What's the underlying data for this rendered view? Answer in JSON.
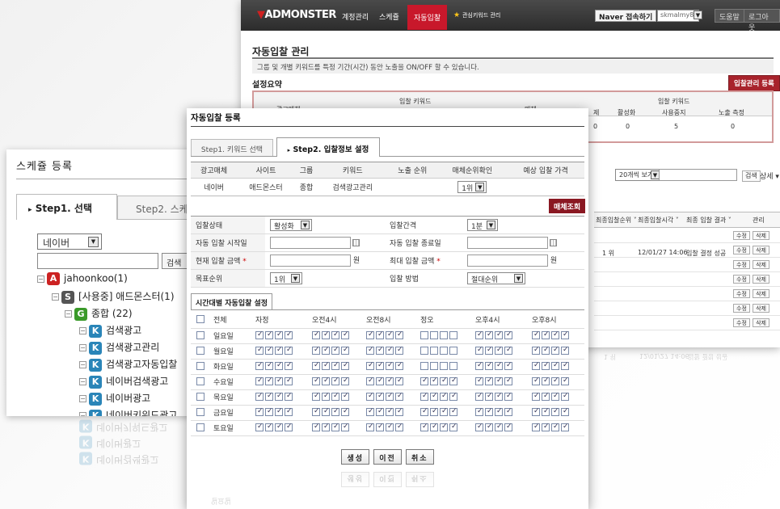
{
  "back": {
    "logo": "ADMONSTER",
    "nav": [
      "계정관리",
      "스케쥴",
      "자동입찰",
      "관심키워드 관리"
    ],
    "naver_label": "Naver 접속하기",
    "account_value": "skmalmy88",
    "help_label": "도움말",
    "logout_label": "로그아웃",
    "page_title": "자동입찰 관리",
    "description": "그룹 및 개별 키워드를 특정 기간(시간) 동안 노출을 ON/OFF 할 수 있습니다.",
    "summary_label": "설정요약",
    "register_button": "입찰관리 등록",
    "summary": {
      "col_media": "광고매체",
      "col_bid_kw": "입찰 키워드",
      "col_media2": "매체",
      "col_bid_kw2": "입찰 키워드",
      "col_stop_frag": "제",
      "col_active": "활성화",
      "col_paused": "사용중지",
      "col_exposure": "노출 측정",
      "val_left": "0",
      "val_active": "0",
      "val_paused": "5",
      "val_exposure": "0"
    },
    "page_size": "20개씩 보기",
    "search_btn": "검색",
    "detail_label": "상세",
    "col_last_rank": "최종입찰순위",
    "col_last_time": "최종입찰시각",
    "col_last_result": "최종 입찰 결과",
    "col_manage": "관리",
    "row_rank": "1 위",
    "row_time": "12/01/27 14:06",
    "row_result": "입찰 결정 성공",
    "edit_btn": "수정",
    "delete_btn": "삭제",
    "faint_rank": "1 위",
    "faint_time": "12/01/27 14:06",
    "faint_result": "입찰 결정 성공"
  },
  "left": {
    "title": "스케쥴 등록",
    "tab1": "Step1. 선택",
    "tab2": "Step2. 스케",
    "select_value": "네이버",
    "search_btn": "검색",
    "tree": {
      "account": "jahoonkoo(1)",
      "site": "[사용중] 애드몬스터(1)",
      "group": "종합 (22)",
      "keywords": [
        "검색광고",
        "검색광고관리",
        "검색광고자동입찰",
        "네이버검색광고",
        "네이버광고",
        "네이버키워드광고"
      ]
    },
    "faint_keywords": [
      "네이버키워드광고",
      "네이버광고",
      "네이버검색광고"
    ],
    "badges": {
      "account": "A",
      "site": "S",
      "group": "G",
      "keyword": "K"
    }
  },
  "modal": {
    "title": "자동입찰 등록",
    "tab1": "Step1. 키워드 선택",
    "tab2": "Step2. 입찰정보 설정",
    "site_headers": [
      "광고매체",
      "사이트",
      "그룹",
      "키워드",
      "노출 순위",
      "매체순위확인",
      "예상 입찰 가격"
    ],
    "site_row": {
      "media": "네이버",
      "site": "애드몬스터",
      "group": "종합",
      "keyword": "검색광고관리",
      "rank": "",
      "rank_select": "1위",
      "price": ""
    },
    "lookup_btn": "매체조회",
    "form": {
      "status_label": "입찰상태",
      "status_value": "활성화",
      "interval_label": "입찰간격",
      "interval_value": "1분",
      "start_label": "자동 입찰 시작일",
      "end_label": "자동 입찰 종료일",
      "current_label": "현재 입찰 금액",
      "max_label": "최대 입찰 금액",
      "won": "원",
      "target_label": "목표순위",
      "target_value": "1위",
      "method_label": "입찰 방법",
      "method_value": "절대순위"
    },
    "schedule_tab": "시간대별 자동입찰 설정",
    "sched_headers": [
      "전체",
      "자정",
      "오전4시",
      "오전8시",
      "정오",
      "오후4시",
      "오후8시"
    ],
    "days": [
      {
        "name": "일요일",
        "blocks": [
          1,
          1,
          1,
          0,
          1,
          1
        ]
      },
      {
        "name": "월요일",
        "blocks": [
          1,
          1,
          1,
          0,
          1,
          1
        ]
      },
      {
        "name": "화요일",
        "blocks": [
          1,
          1,
          1,
          0,
          1,
          1
        ]
      },
      {
        "name": "수요일",
        "blocks": [
          1,
          1,
          1,
          1,
          1,
          1
        ]
      },
      {
        "name": "목요일",
        "blocks": [
          1,
          1,
          1,
          1,
          1,
          1
        ]
      },
      {
        "name": "금요일",
        "blocks": [
          1,
          1,
          1,
          1,
          1,
          1
        ]
      },
      {
        "name": "토요일",
        "blocks": [
          1,
          1,
          1,
          1,
          1,
          1
        ]
      }
    ],
    "buttons": [
      "생성",
      "이전",
      "취소"
    ],
    "reflect_buttons": [
      "생성",
      "이전",
      "취소"
    ],
    "reflect_day": "일요일"
  }
}
